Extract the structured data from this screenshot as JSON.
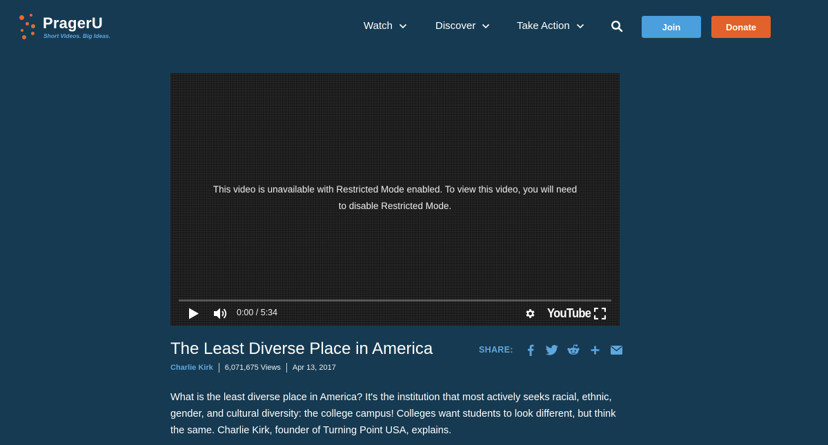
{
  "brand": {
    "name": "PragerU",
    "tagline": "Short Videos. Big Ideas.",
    "accent_color": "#e46a2e",
    "background_color": "#163a51"
  },
  "nav": {
    "items": [
      {
        "label": "Watch",
        "icon": "chevron-down-icon"
      },
      {
        "label": "Discover",
        "icon": "chevron-down-icon"
      },
      {
        "label": "Take Action",
        "icon": "chevron-down-icon"
      }
    ],
    "search_icon": "search-icon",
    "join_label": "Join",
    "join_color": "#4a9fdc",
    "donate_label": "Donate",
    "donate_color": "#e2622b"
  },
  "video": {
    "message": "This video is unavailable with Restricted Mode enabled. To view this video, you will need to disable Restricted Mode.",
    "time": "0:00 / 5:34",
    "provider": "YouTube",
    "progress": 0,
    "controls": [
      "play-icon",
      "volume-icon",
      "settings-gear-icon",
      "fullscreen-icon"
    ]
  },
  "content": {
    "title": "The Least Diverse Place in America",
    "author": "Charlie Kirk",
    "views": "6,071,675 Views",
    "date": "Apr 13, 2017",
    "share_label": "SHARE:",
    "share_icons": [
      "facebook-icon",
      "twitter-icon",
      "reddit-icon",
      "plus-icon",
      "email-icon"
    ],
    "description": "What is the least diverse place in America? It's the institution that most actively seeks racial, ethnic, gender, and cultural diversity: the college campus! Colleges want students to look different, but think the same. Charlie Kirk, founder of Turning Point USA, explains."
  }
}
